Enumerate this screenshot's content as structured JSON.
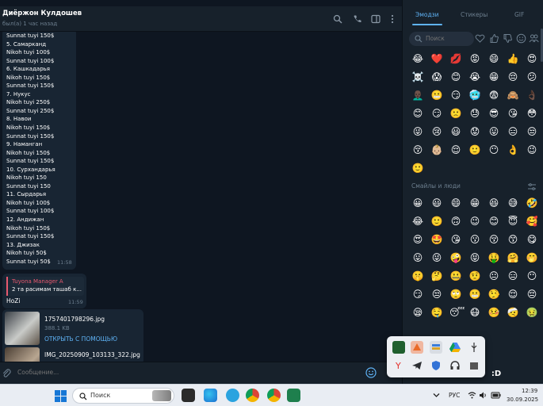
{
  "header": {
    "contact_name": "Диёржон Кулдошев",
    "status": "был(а) 1 час назад"
  },
  "messages": {
    "message1": {
      "lines": [
        "Sunnat tuyi 150$",
        "5. Самарканд",
        "Nikoh tuyi 100$",
        "Sunnat tuyi 100$",
        "6. Кашкадарья",
        "Nikoh tuyi 150$",
        "Sunnat tuyi 150$",
        "7. Нукус",
        "Nikoh tuyi 250$",
        "Sunnat tuyi 250$",
        "8. Навои",
        "Nikoh tuyi 150$",
        "Sunnat tuyi 150$",
        "9. Наманган",
        "Nikoh tuyi 150$",
        "Sunnat tuyi 150$",
        "10. Сурхандарья",
        "Nikoh tuyi 150",
        "Sunnat tuyi 150",
        "11. Сырдарья",
        "Nikoh tuyi 100$",
        "Sunnat tuyi 100$",
        "12. Андижан",
        "Nikoh tuyi 150$",
        "Sunnat tuyi 150$",
        "13. Джизак",
        "Nikoh tuyi 50$",
        "Sunnat tuyi 50$"
      ],
      "time": "11:58"
    },
    "message2": {
      "reply_author": "Tuyona Manager A",
      "reply_text": "2 та расимам ташаб к...",
      "text": "HoZi",
      "time": "11:59"
    },
    "files": [
      {
        "name": "1757401798296.jpg",
        "size": "388.1 KB",
        "action": "ОТКРЫТЬ С ПОМОЩЬЮ"
      },
      {
        "name": "IMG_20250909_103133_322.jpg"
      }
    ]
  },
  "composer": {
    "placeholder": "Сообщение..."
  },
  "emoji_panel": {
    "tabs": [
      "Эмодзи",
      "Стикеры",
      "GIF"
    ],
    "active_tab": "Эмодзи",
    "search_placeholder": "Поиск",
    "recent": [
      "😂",
      "❤️",
      "💋",
      "😡",
      "😄",
      "👍",
      "😍",
      "☠️",
      "😱",
      "😊",
      "😭",
      "😁",
      "😔",
      "😕",
      "👨🏿‍🦲",
      "😬",
      "😏",
      "🥶",
      "😨",
      "🙈",
      "👌🏿",
      "😊",
      "😏",
      "🙁",
      "😓",
      "😎",
      "😘",
      "😳",
      "😜",
      "😢",
      "😃",
      "😟",
      "😛",
      "😑",
      "😒",
      "😚",
      "👶🏼",
      "😌",
      "🙂",
      "😶",
      "👌",
      "😉",
      "🙂"
    ],
    "section_title": "Смайлы и люди",
    "smileys": [
      "😀",
      "😃",
      "😄",
      "😁",
      "😆",
      "😅",
      "🤣",
      "😂",
      "🙂",
      "🙃",
      "😉",
      "😊",
      "😇",
      "🥰",
      "😍",
      "🤩",
      "😘",
      "😗",
      "😚",
      "😙",
      "😋",
      "😛",
      "😜",
      "🤪",
      "😝",
      "🤑",
      "🤗",
      "🤭",
      "🤫",
      "🤔",
      "🤐",
      "🤨",
      "😐",
      "😑",
      "😶",
      "😏",
      "😒",
      "🙄",
      "😬",
      "🤥",
      "😌",
      "😔",
      "😪",
      "🤤",
      "😴",
      "😷",
      "🤒",
      "🤕",
      "🤢"
    ],
    "bottom_row": [
      ":D"
    ]
  },
  "taskbar": {
    "search_placeholder": "Поиск",
    "language": "РУС",
    "time": "12:39",
    "date": "30.09.2025"
  },
  "colors": {
    "chat_bg": "#0e1621",
    "panel_bg": "#17212b",
    "bubble": "#182533",
    "accent": "#5fb3f6",
    "reply_accent": "#e8596f"
  }
}
